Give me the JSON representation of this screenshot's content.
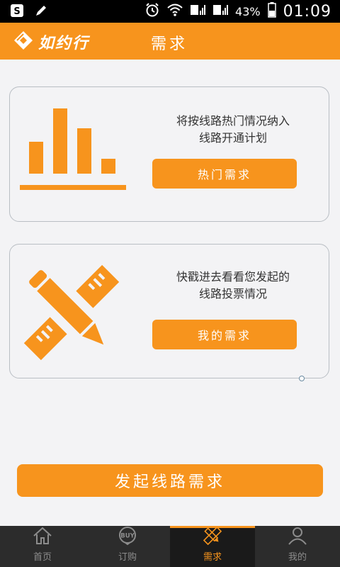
{
  "status_bar": {
    "battery_percent": "43%",
    "time": "01:09"
  },
  "header": {
    "logo_text": "如约行",
    "title": "需求"
  },
  "cards": [
    {
      "text_line1": "将按线路热门情况纳入",
      "text_line2": "线路开通计划",
      "button_label": "热门需求",
      "icon": "bar-chart-icon"
    },
    {
      "text_line1": "快戳进去看看您发起的",
      "text_line2": "线路投票情况",
      "button_label": "我的需求",
      "icon": "pencil-ruler-icon"
    }
  ],
  "cta": {
    "label": "发起线路需求"
  },
  "tabbar": {
    "tabs": [
      {
        "label": "首页",
        "icon": "home-icon",
        "active": false
      },
      {
        "label": "订购",
        "icon": "buy-icon",
        "active": false
      },
      {
        "label": "需求",
        "icon": "pencil-ruler-icon",
        "active": true
      },
      {
        "label": "我的",
        "icon": "person-icon",
        "active": false
      }
    ]
  },
  "colors": {
    "accent": "#f7941d",
    "tabbar_bg": "#2c2c2c",
    "tab_inactive": "#8c8c8c"
  }
}
